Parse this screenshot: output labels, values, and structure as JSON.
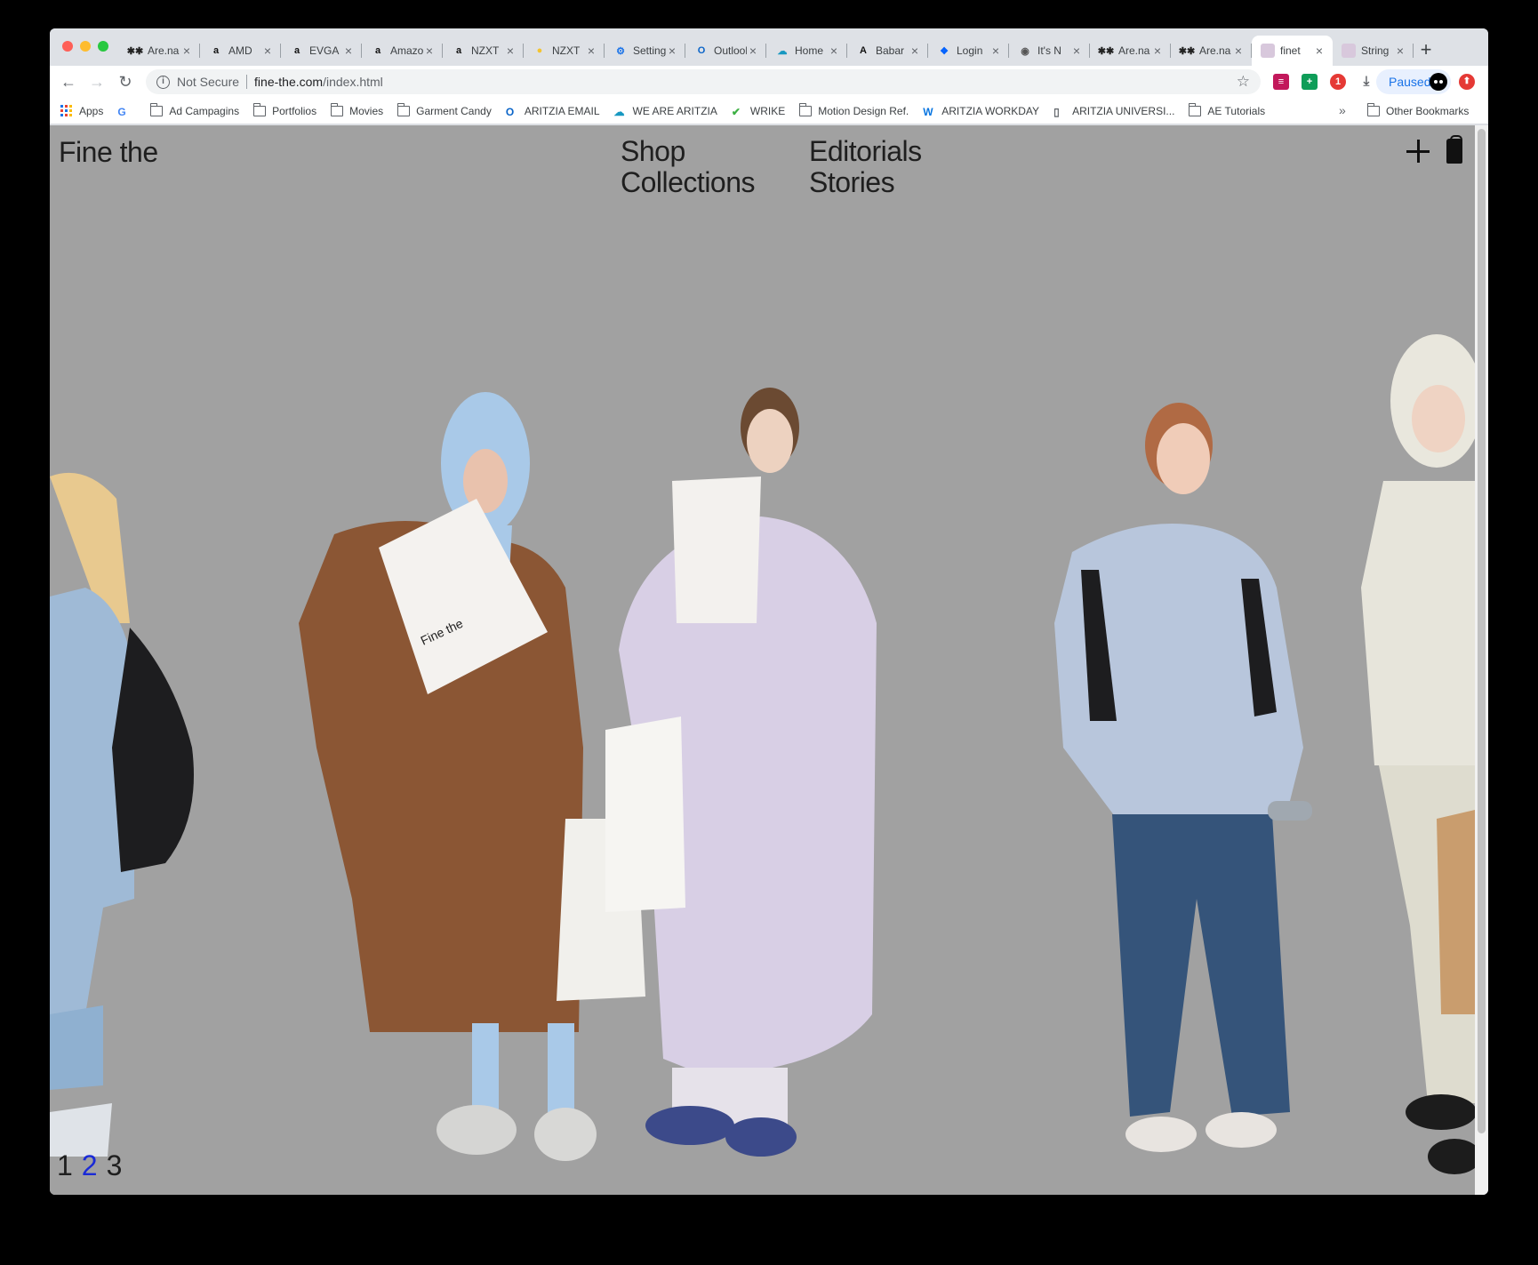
{
  "browser": {
    "tabs": [
      {
        "title": "Are.na",
        "icon": "arena-icon",
        "icon_char": "✱✱",
        "icon_color": "#222222"
      },
      {
        "title": "AMD",
        "icon": "amazon-icon",
        "icon_char": "a",
        "icon_color": "#111111"
      },
      {
        "title": "EVGA",
        "icon": "amazon-icon",
        "icon_char": "a",
        "icon_color": "#111111"
      },
      {
        "title": "Amazon",
        "icon": "amazon-icon",
        "icon_char": "a",
        "icon_color": "#111111"
      },
      {
        "title": "NZXT",
        "icon": "amazon-icon",
        "icon_char": "a",
        "icon_color": "#111111"
      },
      {
        "title": "NZXT",
        "icon": "coin-icon",
        "icon_char": "●",
        "icon_color": "#f4c430"
      },
      {
        "title": "Settings",
        "icon": "gear-icon",
        "icon_char": "⚙",
        "icon_color": "#1a73e8"
      },
      {
        "title": "Outlook",
        "icon": "outlook-icon",
        "icon_char": "O",
        "icon_color": "#0a64c8"
      },
      {
        "title": "Home",
        "icon": "salesforce-icon",
        "icon_char": "☁",
        "icon_color": "#1798c1"
      },
      {
        "title": "Babar",
        "icon": "letter-a-icon",
        "icon_char": "A",
        "icon_color": "#111111"
      },
      {
        "title": "Login",
        "icon": "dropbox-icon",
        "icon_char": "❖",
        "icon_color": "#0061fe"
      },
      {
        "title": "It's N",
        "icon": "globe-icon",
        "icon_char": "◉",
        "icon_color": "#555555"
      },
      {
        "title": "Are.na",
        "icon": "arena-icon",
        "icon_char": "✱✱",
        "icon_color": "#222222"
      },
      {
        "title": "Are.na",
        "icon": "arena-icon",
        "icon_char": "✱✱",
        "icon_color": "#222222"
      },
      {
        "title": "finet",
        "icon": "page-icon",
        "icon_char": "",
        "icon_color": "#d8c8dc",
        "active": true
      },
      {
        "title": "String",
        "icon": "page-icon",
        "icon_char": "",
        "icon_color": "#d8c8dc"
      }
    ],
    "new_tab": "+",
    "address": {
      "security": "Not Secure",
      "host": "fine-the.com",
      "path": "/index.html"
    },
    "profile_label": "Paused",
    "bookmarks": [
      {
        "label": "Apps",
        "icon": "apps-icon"
      },
      {
        "label": "",
        "icon": "google-icon"
      },
      {
        "label": "Ad Campagins",
        "icon": "folder-icon"
      },
      {
        "label": "Portfolios",
        "icon": "folder-icon"
      },
      {
        "label": "Movies",
        "icon": "folder-icon"
      },
      {
        "label": "Garment Candy",
        "icon": "folder-icon"
      },
      {
        "label": "ARITZIA EMAIL",
        "icon": "outlook-icon"
      },
      {
        "label": "WE ARE ARITZIA",
        "icon": "salesforce-icon"
      },
      {
        "label": "WRIKE",
        "icon": "check-icon"
      },
      {
        "label": "Motion Design Ref.",
        "icon": "folder-icon"
      },
      {
        "label": "ARITZIA WORKDAY",
        "icon": "workday-icon"
      },
      {
        "label": "ARITZIA UNIVERSI...",
        "icon": "page-icon"
      },
      {
        "label": "AE Tutorials",
        "icon": "folder-icon"
      }
    ],
    "bookmarks_overflow": "»",
    "other_bookmarks": "Other Bookmarks"
  },
  "site": {
    "logo": "Fine the",
    "nav_left": [
      "Shop",
      "Collections"
    ],
    "nav_right": [
      "Editorials",
      "Stories"
    ],
    "bag_text": "Fine the",
    "pager": [
      "1",
      "2",
      "3"
    ],
    "pager_current": "2"
  }
}
